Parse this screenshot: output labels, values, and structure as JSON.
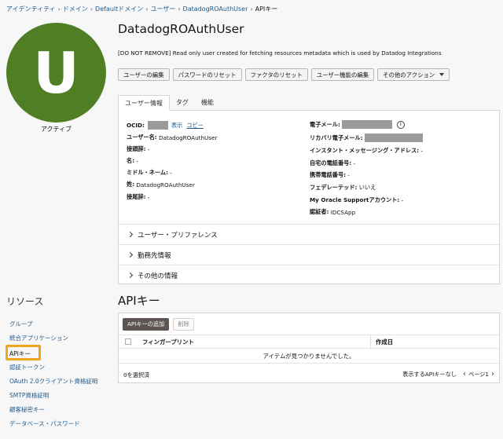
{
  "breadcrumb": [
    "アイデンティティ",
    "ドメイン",
    "Defaultドメイン",
    "ユーザー",
    "DatadogROAuthUser",
    "APIキー"
  ],
  "avatar": {
    "initial": "U",
    "status": "アクティブ",
    "color": "#4f7e24"
  },
  "user": {
    "name": "DatadogROAuthUser",
    "description": "[DO NOT REMOVE] Read only user created for fetching resources metadata which is used by Datadog Integrations"
  },
  "actions": {
    "edit_user": "ユーザーの編集",
    "reset_password": "パスワードのリセット",
    "reset_factors": "ファクタのリセット",
    "edit_capabilities": "ユーザー機能の編集",
    "more_actions": "その他のアクション"
  },
  "tabs": [
    "ユーザー情報",
    "タグ",
    "機能"
  ],
  "info": {
    "ocid_label": "OCID:",
    "show": "表示",
    "copy": "コピー",
    "username_label": "ユーザー名:",
    "username_value": "DatadogROAuthUser",
    "prefix_label": "接頭辞:",
    "prefix_value": "-",
    "first_label": "名:",
    "first_value": "-",
    "middle_label": "ミドル・ネーム:",
    "middle_value": "-",
    "last_label": "姓:",
    "last_value": "DatadogROAuthUser",
    "suffix_label": "接尾辞:",
    "suffix_value": "-",
    "email_label": "電子メール:",
    "recovery_label": "リカバリ電子メール:",
    "im_label": "インスタント・メッセージング・アドレス:",
    "im_value": "-",
    "home_label": "自宅の電話番号:",
    "home_value": "-",
    "mobile_label": "携帯電話番号:",
    "mobile_value": "-",
    "federated_label": "フェデレーテッド:",
    "federated_value": "いいえ",
    "mos_label": "My Oracle Supportアカウント:",
    "mos_value": "-",
    "cert_label": "認証者:",
    "cert_value": "IDCSApp"
  },
  "accordions": [
    "ユーザー・プリファレンス",
    "勤務先情報",
    "その他の情報"
  ],
  "resources": {
    "title": "リソース",
    "items": [
      "グループ",
      "統合アプリケーション",
      "APIキー",
      "認証トークン",
      "OAuth 2.0クライアント資格証明",
      "SMTP資格証明",
      "顧客秘密キー",
      "データベース・パスワード"
    ],
    "active_index": 2,
    "highlight_color": "#f0a51e"
  },
  "api_keys": {
    "title": "APIキー",
    "add_button": "APIキーの追加",
    "delete_button": "削除",
    "columns": [
      "フィンガープリント",
      "作成日"
    ],
    "empty": "アイテムが見つかりませんでした。",
    "selected": "0を選択済",
    "showing": "表示するAPIキーなし",
    "page": "ページ1"
  }
}
